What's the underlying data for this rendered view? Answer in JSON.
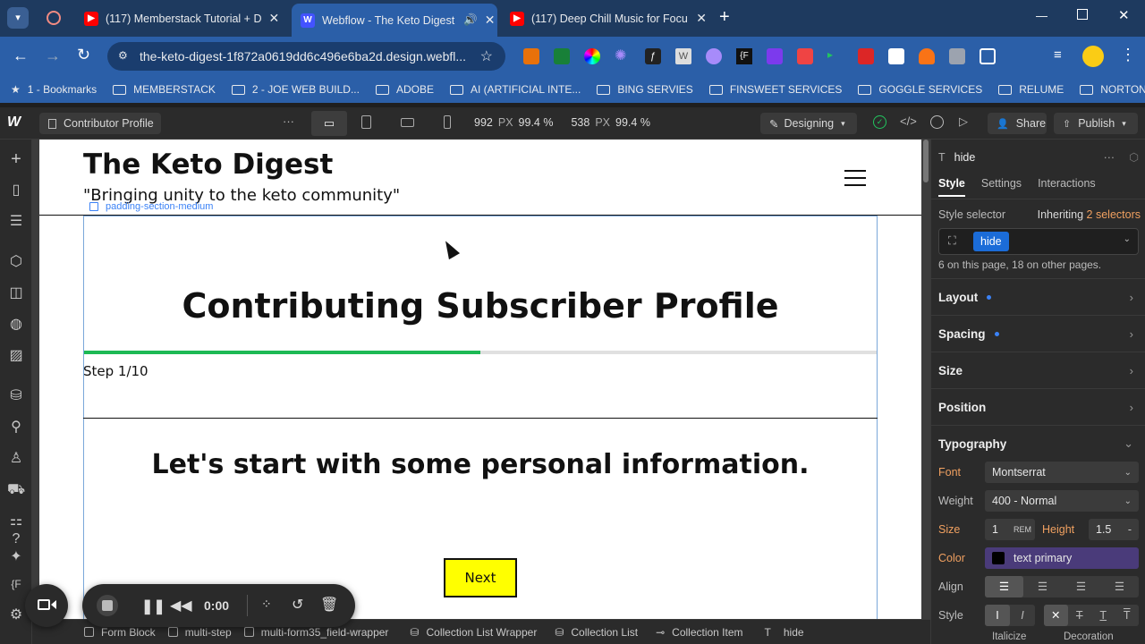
{
  "browser": {
    "tabs": [
      {
        "title": "(117) Memberstack Tutorial + D",
        "icon": "youtube-icon"
      },
      {
        "title": "Webflow - The Keto Digest",
        "icon": "webflow-icon",
        "active": true
      },
      {
        "title": "(117) Deep Chill Music for Focu",
        "icon": "youtube-icon"
      }
    ],
    "url": "the-keto-digest-1f872a0619dd6c496e6ba2d.design.webfl...",
    "bookmarks": [
      "1 - Bookmarks",
      "MEMBERSTACK",
      "2 - JOE WEB BUILD...",
      "ADOBE",
      "AI (ARTIFICIAL INTE...",
      "BING SERVIES",
      "FINSWEET SERVICES",
      "GOGGLE SERVICES",
      "RELUME",
      "NORTON"
    ]
  },
  "designer": {
    "page_name": "Contributor Profile",
    "width_value": "992",
    "width_unit": "PX",
    "width_pct": "99.4 %",
    "height_value": "538",
    "height_unit": "PX",
    "height_pct": "99.4 %",
    "mode": "Designing",
    "share_label": "Share",
    "publish_label": "Publish"
  },
  "canvas": {
    "site_title": "The Keto Digest",
    "tagline": "\"Bringing unity to the keto community\"",
    "selected_class_label": "padding-section-medium",
    "heading": "Contributing Subscriber Profile",
    "progress": 0.5,
    "step_label": "Step 1/10",
    "subheading": "Let's start with some personal information.",
    "next_label": "Next",
    "colors": {
      "progress": "#1db954",
      "button": "#ffff00"
    }
  },
  "panel": {
    "element_name": "hide",
    "tabs": [
      "Style",
      "Settings",
      "Interactions"
    ],
    "style_selector_label": "Style selector",
    "inheriting_label": "Inheriting",
    "inheriting_count": "2 selectors",
    "class_chip": "hide",
    "usage_text": "6 on this page, 18 on other pages.",
    "sections": [
      "Layout",
      "Spacing",
      "Size",
      "Position",
      "Typography"
    ],
    "font_label": "Font",
    "font_value": "Montserrat",
    "weight_label": "Weight",
    "weight_value": "400 - Normal",
    "size_label": "Size",
    "size_value": "1",
    "size_unit": "REM",
    "height_label": "Height",
    "height_value": "1.5",
    "height_suffix": "-",
    "color_label": "Color",
    "color_value": "text primary",
    "align_label": "Align",
    "style_label": "Style",
    "italicize_label": "Italicize",
    "decoration_label": "Decoration"
  },
  "breadcrumbs": [
    "Form Block",
    "multi-step",
    "multi-form35_field-wrapper",
    "Collection List Wrapper",
    "Collection List",
    "Collection Item",
    "hide"
  ],
  "recorder": {
    "time": "0:00"
  }
}
